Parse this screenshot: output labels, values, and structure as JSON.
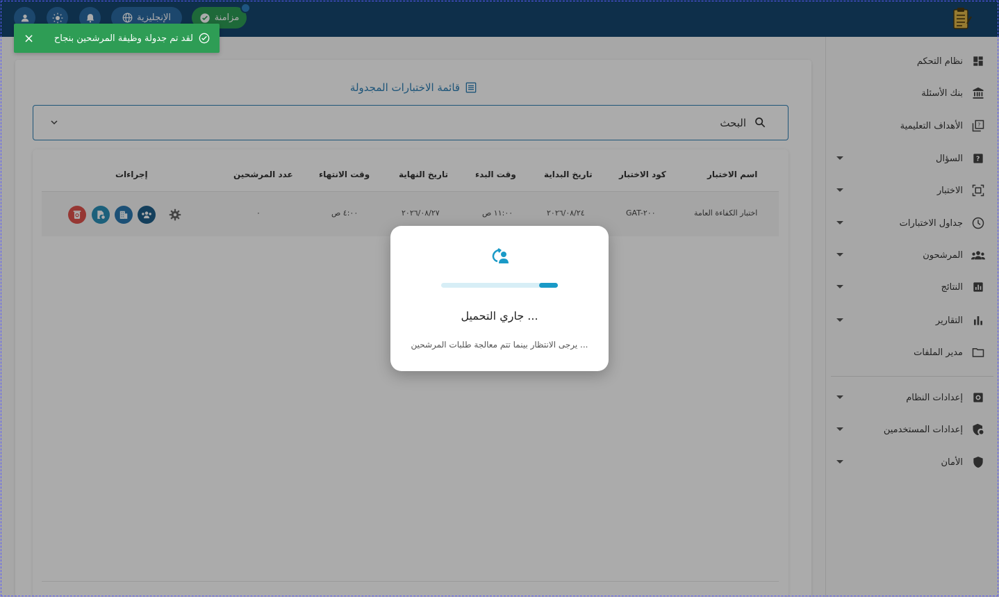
{
  "topbar": {
    "sync_label": "مزامنة",
    "language_label": "الإنجليزية"
  },
  "toast": {
    "message": "لقد تم جدولة وظيفة المرشحين بنجاح",
    "close": "×"
  },
  "sidebar": {
    "items": [
      {
        "label": "نظام التحكم",
        "icon": "dashboard-icon"
      },
      {
        "label": "بنك الأسئلة",
        "icon": "bank-icon"
      },
      {
        "label": "الأهداف التعليمية",
        "icon": "objectives-icon"
      },
      {
        "label": "السؤال",
        "icon": "question-icon",
        "expandable": true
      },
      {
        "label": "الاختبار",
        "icon": "exam-icon",
        "expandable": true
      },
      {
        "label": "جداول الاختبارات",
        "icon": "clock-icon",
        "expandable": true
      },
      {
        "label": "المرشحون",
        "icon": "candidates-icon",
        "expandable": true
      },
      {
        "label": "النتائج",
        "icon": "results-icon",
        "expandable": true
      },
      {
        "label": "التقارير",
        "icon": "reports-icon",
        "expandable": true
      },
      {
        "label": "مدير الملفات",
        "icon": "folder-icon"
      }
    ],
    "settings_items": [
      {
        "label": "إعدادات النظام",
        "icon": "system-settings-icon",
        "expandable": true
      },
      {
        "label": "إعدادات المستخدمين",
        "icon": "user-settings-icon",
        "expandable": true
      },
      {
        "label": "الأمان",
        "icon": "shield-icon",
        "expandable": true
      }
    ]
  },
  "main": {
    "title": "قائمة الاختبارات المجدولة",
    "search_label": "البحث",
    "table": {
      "headers": [
        "اسم الاختبار",
        "كود الاختبار",
        "تاريخ البداية",
        "وقت البدء",
        "تاريخ النهاية",
        "وقت الانتهاء",
        "عدد المرشحين",
        "إجراءات"
      ],
      "rows": [
        [
          "اختبار الكفاءة العامة",
          "GAT-٢٠٠",
          "٢٠٢٦/٠٨/٢٤",
          "١١:٠٠ ص",
          "٢٠٢٦/٠٨/٢٧",
          "٤:٠٠ ص",
          "٠"
        ]
      ]
    }
  },
  "modal": {
    "title": "جاري التحميل ...",
    "subtitle": "يرجى الانتظار بينما تتم معالجة طلبات المرشحين ...",
    "progress": 0.16
  },
  "colors": {
    "topbar": "#15466f",
    "accent": "#2d7fb5",
    "success": "#2e9d55",
    "danger": "#e0524c"
  }
}
